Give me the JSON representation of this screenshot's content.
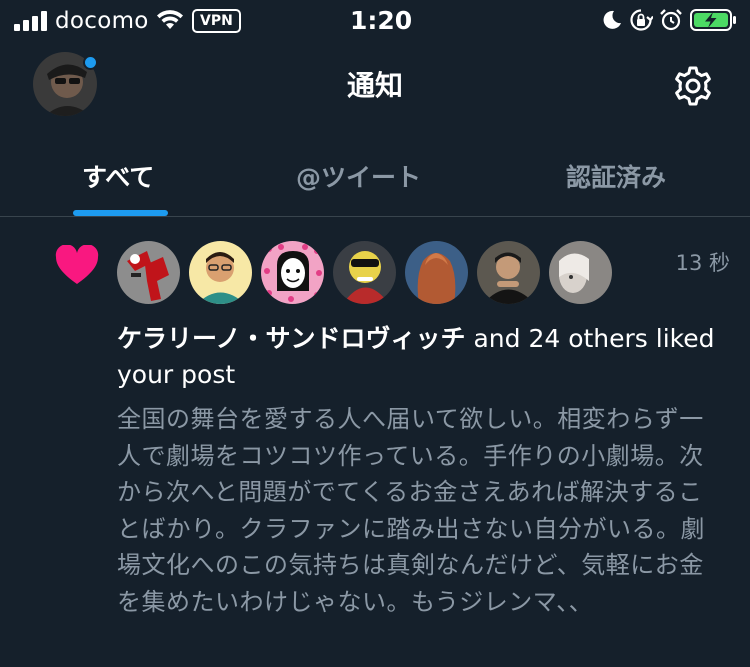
{
  "status_bar": {
    "carrier": "docomo",
    "vpn": "VPN",
    "time": "1:20",
    "signal_bars": 4,
    "battery_state": "charging"
  },
  "header": {
    "title": "通知"
  },
  "tabs": [
    {
      "label": "すべて",
      "selected": true
    },
    {
      "label": "@ツイート",
      "selected": false
    },
    {
      "label": "認証済み",
      "selected": false
    }
  ],
  "notification": {
    "type_icon": "heart-icon",
    "timestamp": "13 秒",
    "actor": "ケラリーノ・サンドロヴィッチ",
    "action": " and 24 others liked your post",
    "post_text": "全国の舞台を愛する人へ届いて欲しい。相変わらず一人で劇場をコツコツ作っている。手作りの小劇場。次から次へと問題がでてくるお金さえあれば解決することばかり。クラファンに踏み出さない自分がいる。劇場文化へのこの気持ちは真剣なんだけど、気軽にお金を集めたいわけじゃない。もうジレンマ、、",
    "liker_count_shown": 8
  },
  "colors": {
    "background": "#15202b",
    "accent": "#1d9bf0",
    "like": "#f91880",
    "muted_text": "#8b98a5",
    "divider": "#38444d"
  }
}
